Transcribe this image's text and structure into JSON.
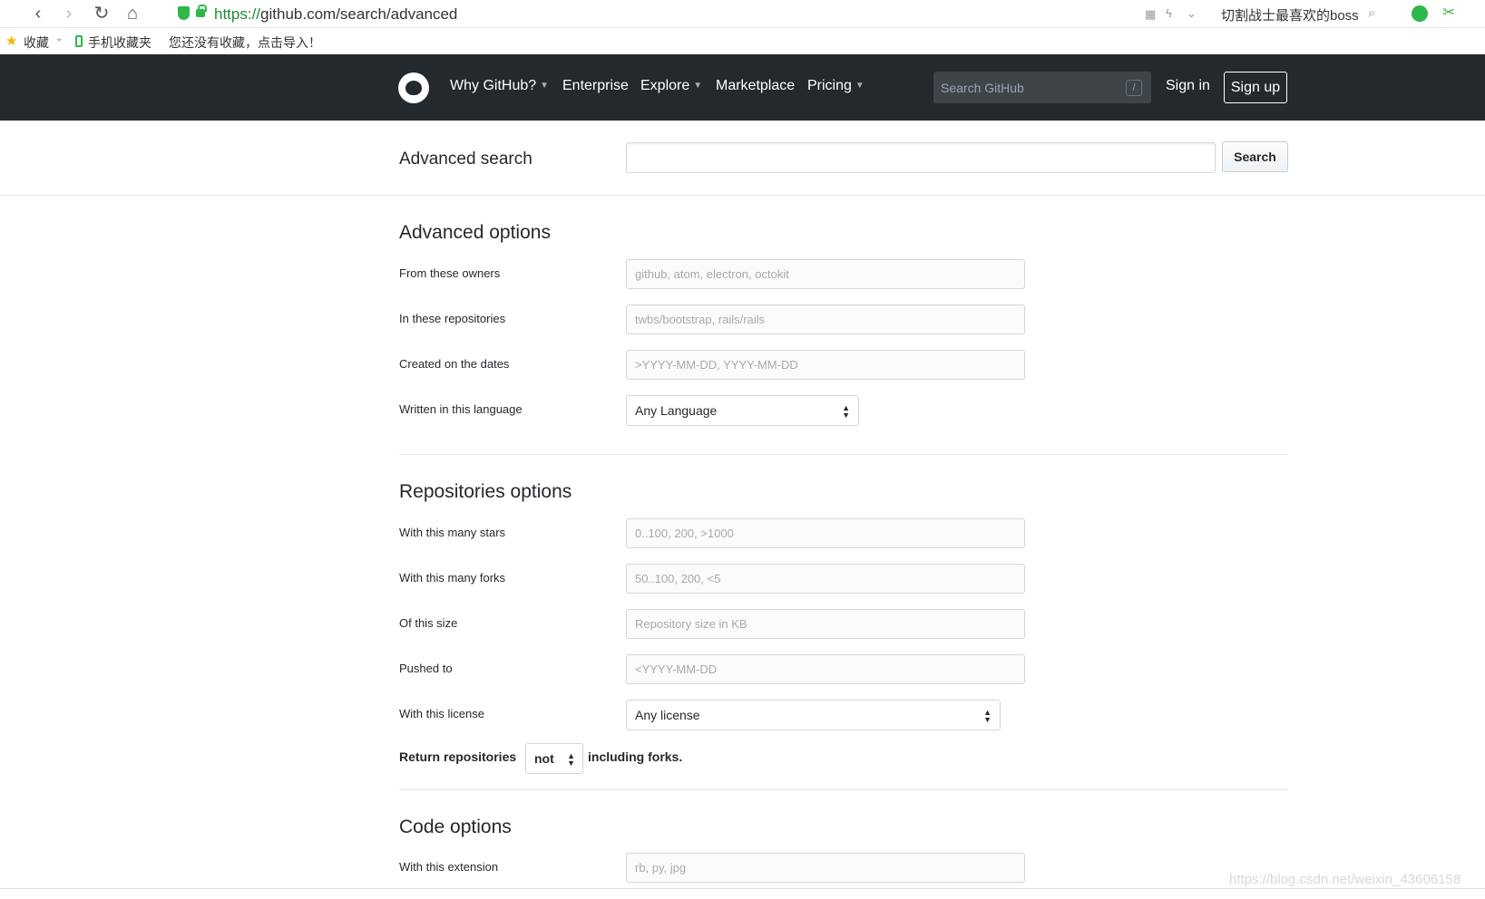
{
  "browser": {
    "url_scheme": "https://",
    "url_rest": "github.com/search/advanced",
    "right_text": "切割战士最喜欢的boss",
    "bookmarks": {
      "favorites": "收藏",
      "mobile": "手机收藏夹",
      "import_hint": "您还没有收藏，点击导入！"
    }
  },
  "header": {
    "nav": [
      "Why GitHub?",
      "Enterprise",
      "Explore",
      "Marketplace",
      "Pricing"
    ],
    "search_placeholder": "Search GitHub",
    "slash": "/",
    "sign_in": "Sign in",
    "sign_up": "Sign up"
  },
  "advanced_search": {
    "title": "Advanced search",
    "button": "Search"
  },
  "advanced_options": {
    "title": "Advanced options",
    "owners_label": "From these owners",
    "owners_placeholder": "github, atom, electron, octokit",
    "repos_label": "In these repositories",
    "repos_placeholder": "twbs/bootstrap, rails/rails",
    "dates_label": "Created on the dates",
    "dates_placeholder": ">YYYY-MM-DD, YYYY-MM-DD",
    "language_label": "Written in this language",
    "language_value": "Any Language"
  },
  "repo_options": {
    "title": "Repositories options",
    "stars_label": "With this many stars",
    "stars_placeholder": "0..100, 200, >1000",
    "forks_label": "With this many forks",
    "forks_placeholder": "50..100, 200, <5",
    "size_label": "Of this size",
    "size_placeholder": "Repository size in KB",
    "pushed_label": "Pushed to",
    "pushed_placeholder": "<YYYY-MM-DD",
    "license_label": "With this license",
    "license_value": "Any license",
    "return_prefix": "Return repositories",
    "return_value": "not",
    "return_suffix": "including forks."
  },
  "code_options": {
    "title": "Code options",
    "extension_label": "With this extension",
    "extension_placeholder": "rb, py, jpg"
  },
  "watermark": "https://blog.csdn.net/weixin_43606158"
}
